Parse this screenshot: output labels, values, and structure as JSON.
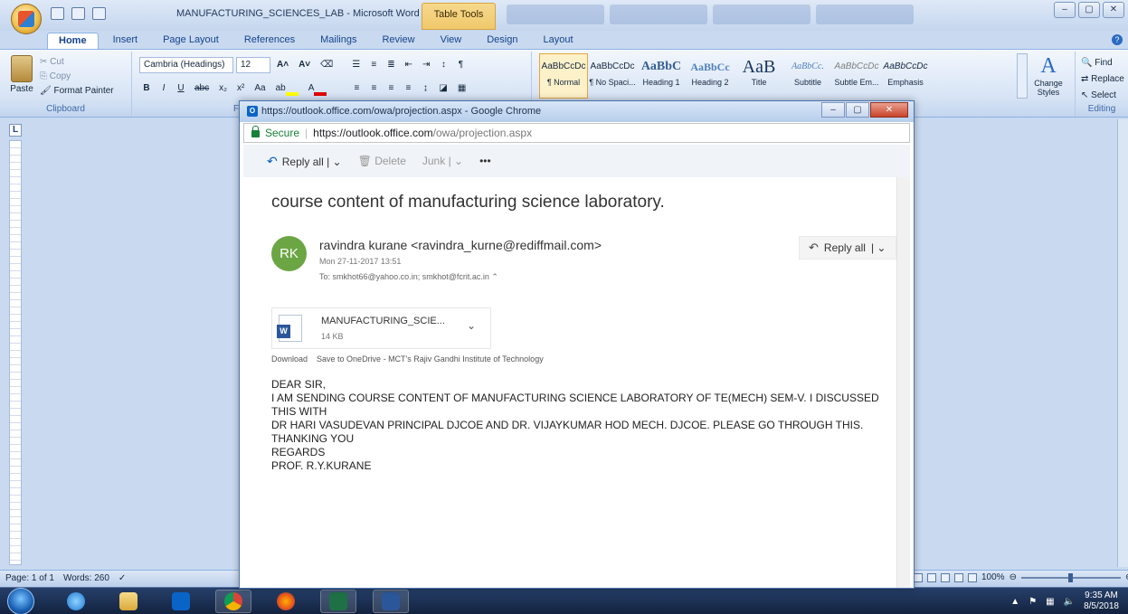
{
  "word": {
    "title": "MANUFACTURING_SCIENCES_LAB - Microsoft Word",
    "contextual_tab": "Table Tools",
    "tabs": [
      "Home",
      "Insert",
      "Page Layout",
      "References",
      "Mailings",
      "Review",
      "View",
      "Design",
      "Layout"
    ],
    "window_controls": [
      "–",
      "▢",
      "✕"
    ],
    "clipboard": {
      "paste": "Paste",
      "cut": "Cut",
      "copy": "Copy",
      "format_painter": "Format Painter",
      "label": "Clipboard"
    },
    "font": {
      "name": "Cambria (Headings)",
      "size": "12",
      "label_fragment": "F"
    },
    "styles": [
      {
        "preview": "AaBbCcDc",
        "name": "¶ Normal"
      },
      {
        "preview": "AaBbCcDc",
        "name": "¶ No Spaci..."
      },
      {
        "preview": "AaBbC",
        "name": "Heading 1"
      },
      {
        "preview": "AaBbCc",
        "name": "Heading 2"
      },
      {
        "preview": "AaB",
        "name": "Title"
      },
      {
        "preview": "AaBbCc.",
        "name": "Subtitle"
      },
      {
        "preview": "AaBbCcDc",
        "name": "Subtle Em..."
      },
      {
        "preview": "AaBbCcDc",
        "name": "Emphasis"
      }
    ],
    "change_styles": "Change Styles",
    "editing": {
      "find": "Find",
      "replace": "Replace",
      "select": "Select",
      "label": "Editing"
    },
    "status": {
      "page": "Page: 1 of 1",
      "words": "Words: 260",
      "zoom": "100%"
    }
  },
  "chrome": {
    "window_title": "https://outlook.office.com/owa/projection.aspx - Google Chrome",
    "secure_label": "Secure",
    "url_host": "https://outlook.office.com",
    "url_path": "/owa/projection.aspx"
  },
  "owa": {
    "toolbar": {
      "reply_all": "Reply all",
      "delete": "Delete",
      "junk": "Junk",
      "more": "•••"
    },
    "subject": "course content of manufacturing science laboratory.",
    "sender_initials": "RK",
    "sender": "ravindra kurane <ravindra_kurne@rediffmail.com>",
    "date": "Mon 27-11-2017 13:51",
    "to": "To:  smkhot66@yahoo.co.in; smkhot@fcrit.ac.in",
    "reply_all_button": "Reply all",
    "attachment": {
      "name": "MANUFACTURING_SCIE...",
      "size": "14 KB"
    },
    "attachment_links": [
      "Download",
      "Save to OneDrive - MCT's Rajiv Gandhi Institute of Technology"
    ],
    "body_lines": [
      "DEAR SIR,",
      "I AM SENDING COURSE CONTENT OF MANUFACTURING SCIENCE LABORATORY OF TE(MECH) SEM-V. I DISCUSSED THIS WITH",
      "DR HARI VASUDEVAN PRINCIPAL DJCOE AND DR. VIJAYKUMAR HOD MECH. DJCOE. PLEASE GO THROUGH THIS.",
      "THANKING YOU",
      "REGARDS",
      "PROF. R.Y.KURANE"
    ]
  },
  "taskbar": {
    "apps": [
      "ie-icon",
      "explorer-icon",
      "outlook-icon",
      "chrome-icon",
      "firefox-icon",
      "excel-icon",
      "word-icon"
    ],
    "time": "9:35 AM",
    "date": "8/5/2018"
  }
}
